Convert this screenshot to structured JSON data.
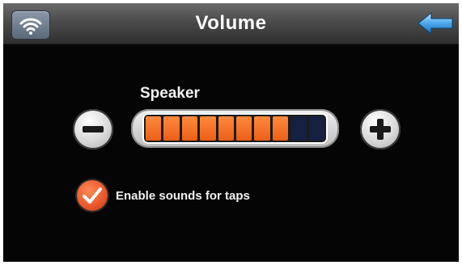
{
  "header": {
    "title": "Volume",
    "left_icon": "wifi-icon",
    "right_icon": "back-arrow-icon"
  },
  "volume": {
    "label": "Speaker",
    "level": 8,
    "max_level": 10,
    "decrease_icon": "minus-icon",
    "increase_icon": "plus-icon"
  },
  "options": {
    "tap_sounds_label": "Enable sounds for taps",
    "tap_sounds_checked": true
  },
  "colors": {
    "accent": "#ec5f18",
    "segment_off": "#162040",
    "background": "#050505"
  }
}
